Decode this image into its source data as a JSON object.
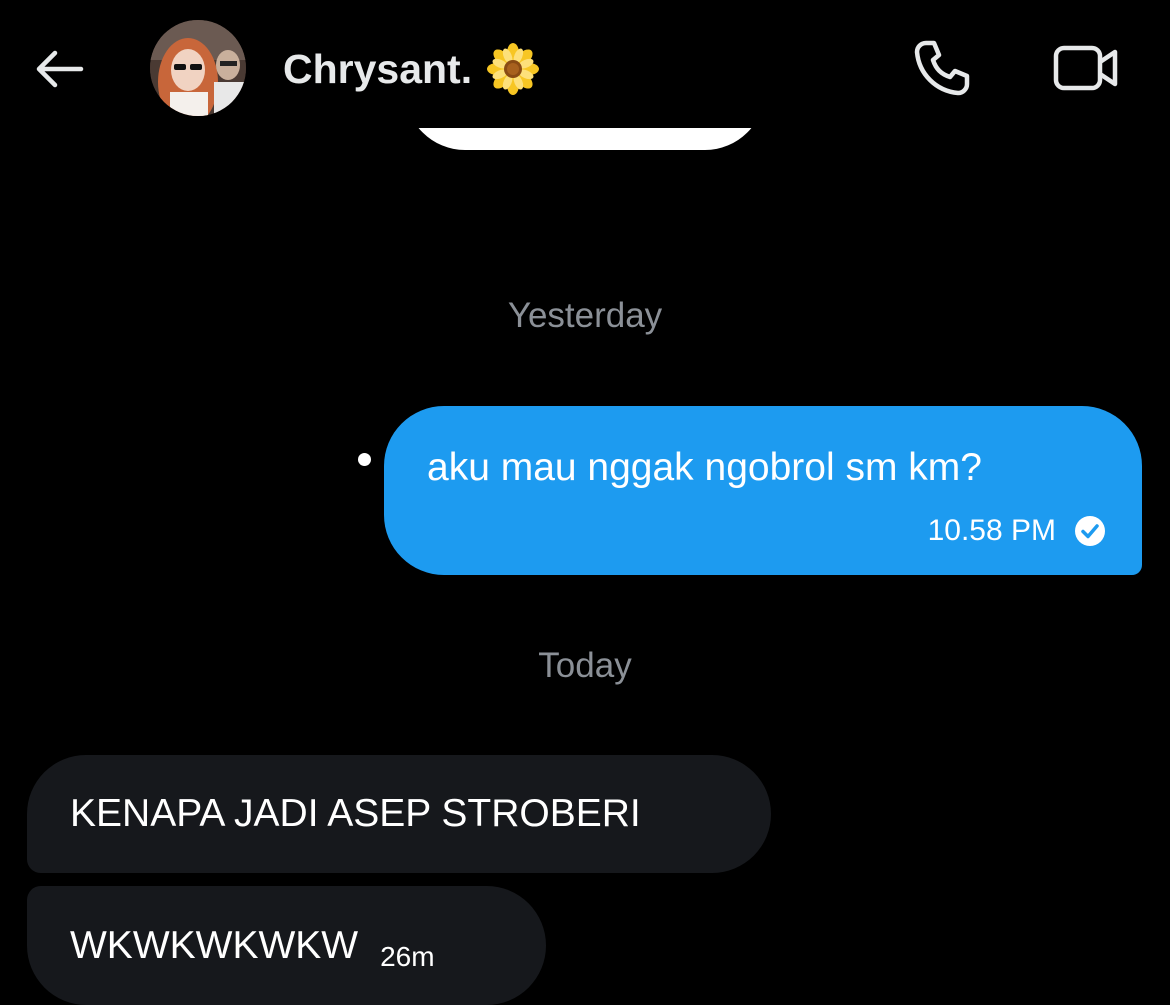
{
  "header": {
    "contact_name": "Chrysant.",
    "name_emoji_icon": "sunflower-icon",
    "back_icon": "arrow-left-icon",
    "call_icon": "phone-icon",
    "video_icon": "video-camera-icon"
  },
  "conversation": {
    "separators": {
      "yesterday": "Yesterday",
      "today": "Today"
    },
    "sent_message": {
      "text": "aku mau nggak ngobrol sm km?",
      "time": "10.58 PM",
      "status_icon": "read-check-icon"
    },
    "received_messages": [
      {
        "text": "KENAPA JADI ASEP STROBERI",
        "time": ""
      },
      {
        "text": "WKWKWKWKW",
        "time": "26m"
      }
    ]
  },
  "colors": {
    "background": "#000000",
    "sent_bubble": "#1d9bf0",
    "received_bubble": "#16181c",
    "separator_text": "#8b9097"
  }
}
